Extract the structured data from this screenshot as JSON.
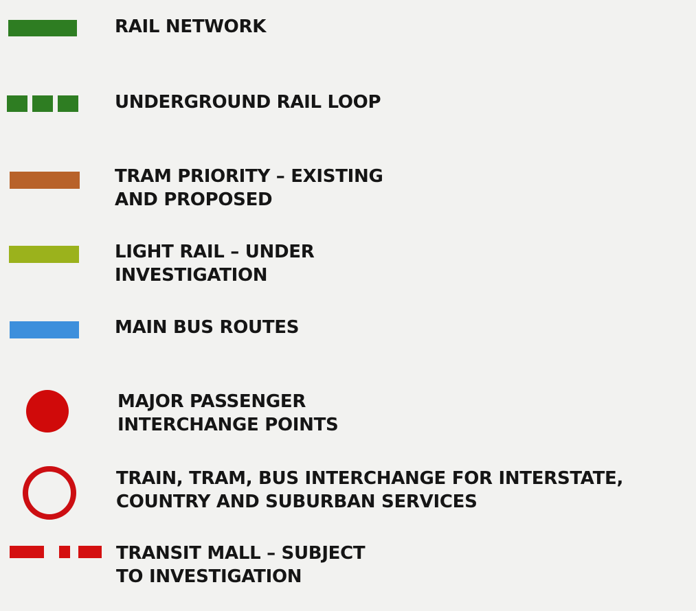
{
  "legend": {
    "items": [
      {
        "symbol": "solid-line",
        "color": "#2e7d22",
        "lines": [
          "RAIL NETWORK"
        ]
      },
      {
        "symbol": "dashed-line",
        "color": "#2e7d22",
        "lines": [
          "UNDERGROUND RAIL LOOP"
        ]
      },
      {
        "symbol": "solid-line",
        "color": "#b8622a",
        "lines": [
          "TRAM PRIORITY – EXISTING",
          "AND PROPOSED"
        ]
      },
      {
        "symbol": "solid-line",
        "color": "#9bb21c",
        "lines": [
          "LIGHT RAIL – UNDER",
          "INVESTIGATION"
        ]
      },
      {
        "symbol": "solid-line",
        "color": "#3d8fdc",
        "lines": [
          "MAIN BUS ROUTES"
        ]
      },
      {
        "symbol": "filled-circle",
        "color": "#d00a0a",
        "lines": [
          "MAJOR PASSENGER",
          "INTERCHANGE POINTS"
        ]
      },
      {
        "symbol": "ring",
        "color": "#cc0e12",
        "lines": [
          "TRAIN, TRAM, BUS INTERCHANGE FOR INTERSTATE,",
          "COUNTRY AND SUBURBAN SERVICES"
        ]
      },
      {
        "symbol": "dash-dot-line",
        "color": "#d41010",
        "lines": [
          "TRANSIT MALL – SUBJECT",
          "TO INVESTIGATION"
        ]
      }
    ]
  }
}
